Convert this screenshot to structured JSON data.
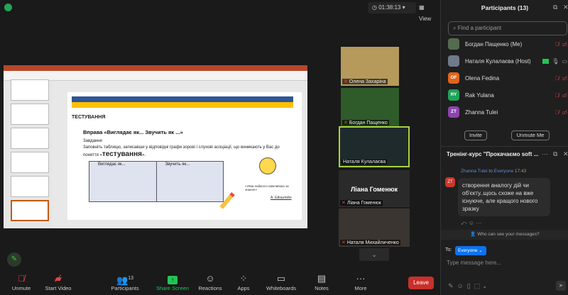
{
  "header": {
    "timer": "01:38:13",
    "view_label": "View"
  },
  "slide": {
    "heading": "ТЕСТУВАННЯ",
    "title": "Вправа «Виглядає як... Звучить як ...»",
    "task_label": "Завдання",
    "task_text": "Заповніть таблицю, записавши у відповідні графи зорові і слухові асоціації, що виникають у Вас до поняття «",
    "task_keyword": "тестування",
    "task_end": "».",
    "col1": "Виглядає як...",
    "col2": "Звучить як...",
    "quote": "«Уява набагато важливіша за знання»",
    "author": "А. Ейнштейн"
  },
  "videos": [
    {
      "name": "Олена Захаріна",
      "muted": true
    },
    {
      "name": "Богдан Пащенко",
      "muted": true
    },
    {
      "name": "Наталя Кулалаєва",
      "muted": false
    },
    {
      "name": "Ліана Гоменюк",
      "muted": true
    },
    {
      "name": "Наталя Михайличенко",
      "muted": true
    }
  ],
  "toolbar": {
    "unmute": "Unmute",
    "start_video": "Start Video",
    "participants": "Participants",
    "participants_count": "13",
    "share_screen": "Share Screen",
    "reactions": "Reactions",
    "apps": "Apps",
    "whiteboards": "Whiteboards",
    "notes": "Notes",
    "more": "More",
    "leave": "Leave"
  },
  "participants": {
    "title": "Participants (13)",
    "search_placeholder": "Find a participant",
    "list": [
      {
        "name": "Богдан Пащенко (Me)",
        "initials": "",
        "color": "#556b4f"
      },
      {
        "name": "Наталя Кулалаєва (Host)",
        "initials": "",
        "color": "#6f7a8a"
      },
      {
        "name": "Olena Fedina",
        "initials": "OF",
        "color": "#e0651b"
      },
      {
        "name": "Rak Yulana",
        "initials": "RY",
        "color": "#1fa35a"
      },
      {
        "name": "Zhanna Tulei",
        "initials": "ZT",
        "color": "#8e44ad"
      }
    ],
    "invite": "Invite",
    "unmute_me": "Unmute Me"
  },
  "chat": {
    "title": "Тренінг-курс \"Прокачаємо soft ...",
    "sender": "Zhanna Tulei",
    "to_word": "to",
    "recipient": "Everyone",
    "time": "17:43",
    "initials": "ZT",
    "message": "створення аналогу дій чи об'єкту..щось схоже на вже існуюче, але кращого нового зразку",
    "who_can_see": "Who can see your messages?",
    "to_label": "To:",
    "to_value": "Everyone",
    "placeholder": "Type message here..."
  },
  "colors": {
    "accent": "#0e72ed",
    "share": "#23c552",
    "leave": "#c9302c",
    "muted": "#e04444"
  }
}
